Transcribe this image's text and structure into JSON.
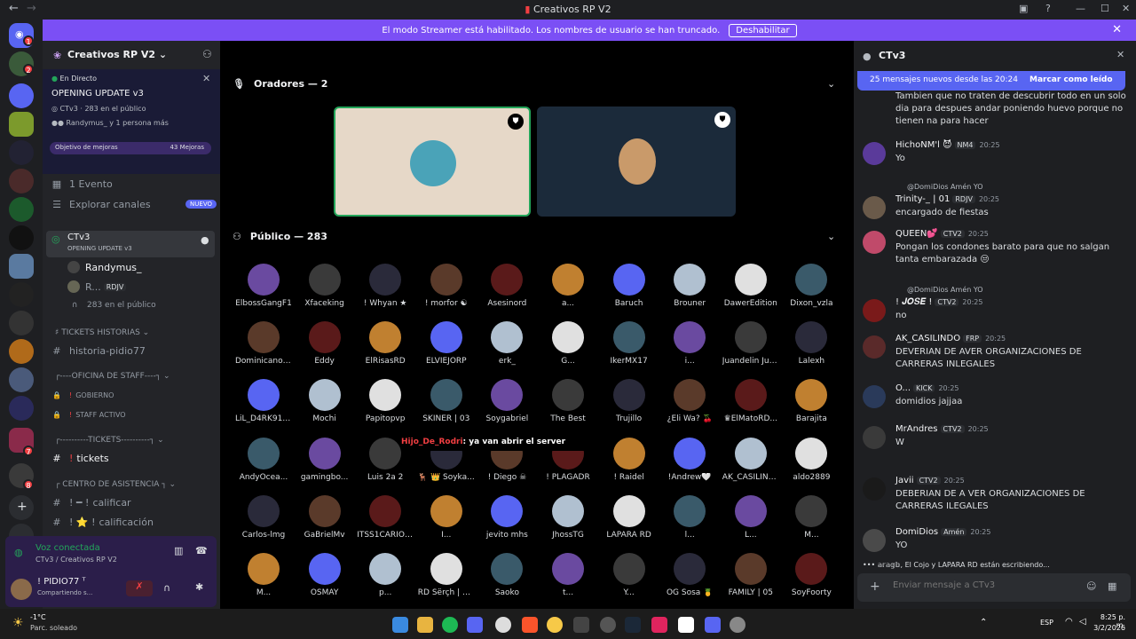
{
  "window": {
    "title": "Creativos RP V2"
  },
  "banner": {
    "text": "El modo Streamer está habilitado. Los nombres de usuario se han truncado.",
    "button": "Deshabilitar"
  },
  "rail_badges": [
    "1",
    "2",
    "2",
    "7",
    "8"
  ],
  "server": {
    "name": "Creativos RP V2",
    "live_label": "En Directo",
    "event_title": "OPENING UPDATE v3",
    "event_channel": "CTv3",
    "event_audience": "283 en el público",
    "event_people": "Randymus_ y 1 persona más",
    "boost_label": "Objetivo de mejoras",
    "boost_count": "43 Mejoras",
    "events_link": "1 Evento",
    "explore_link": "Explorar canales",
    "explore_badge": "NUEVO",
    "stage_channel": "CTv3",
    "stage_topic": "OPENING UPDATE v3",
    "stage_members": [
      "Randymus_",
      "R..."
    ],
    "stage_member_tag": "RDJV",
    "stage_audience": "283 en el público",
    "cat_tickets_hist": "TICKETS HISTORIAS",
    "ch_historia": "historia-pidio77",
    "cat_staff": "┌----OFICINA DE STAFF----┐",
    "ch_gobierno": "GOBIERNO",
    "ch_staff_activo": "STAFF ACTIVO",
    "cat_tickets": "┌----------TICKETS----------┐",
    "ch_tickets": "tickets",
    "cat_asistencia": "┌ CENTRO DE ASISTENCIA ┐",
    "ch_calificar": "calificar",
    "ch_calificacion": "calificación"
  },
  "voice": {
    "status": "Voz conectada",
    "location": "CTv3 / Creativos RP V2",
    "username": "! PIDIO77 ᵀ",
    "substatus": "Compartiendo s..."
  },
  "stage": {
    "speakers_label": "Oradores — 2",
    "audience_label": "Público — 283",
    "speaker_colors": [
      "#e6d8c8",
      "#1b2a3a"
    ],
    "audience": [
      [
        "ElbossGangF1",
        "Xfaceking",
        "! Whyan ★",
        "! morfor ☯",
        "Asesinord",
        "a...",
        "Baruch",
        "Brouner",
        "DawerEdition",
        "Dixon_vzla"
      ],
      [
        "DominicanoG...",
        "Eddy",
        "ElRisasRD",
        "ELVIEJORP",
        "erk_",
        "G...",
        "IkerMX17",
        "i...",
        "Juandelin Jue...",
        "Lalexh"
      ],
      [
        "LiL_D4RK914 ...",
        "Mochi",
        "Papitopvp",
        "SKINER | 03",
        "Soygabriel",
        "The Best",
        "Trujillo",
        "¿Eli Wa? 🍒",
        "♛ElMatoRD...",
        "Barajita"
      ],
      [
        "AndyOcea...",
        "gamingbo...",
        "Luis 2a 2",
        "🦌 👑 Soyka...",
        "! Diego ☠",
        "! PLAGADR",
        "! Raidel",
        "!Andrew🤍",
        "AK_CASILINDO",
        "aldo2889"
      ],
      [
        "Carlos-lmg",
        "GaBrielMv",
        "ITSS1CARIO O...",
        "I...",
        "jevito mhs",
        "JhossTG",
        "LAPARA RD",
        "l...",
        "L...",
        "M..."
      ],
      [
        "M...",
        "OSMAY",
        "p...",
        "RD Šërçh | 20 ...",
        "Saoko",
        "t...",
        "Y...",
        "OG Sosa 🍍",
        "FAMILY | 05",
        "SoyFoorty"
      ]
    ]
  },
  "chat": {
    "channel": "CTv3",
    "new_messages": "25 mensajes nuevos desde las 20:24",
    "mark_read": "Marcar como leído",
    "placeholder": "Enviar mensaje a CTv3",
    "typing": "𝕒𝕣𝕒𝕘𝕓, El Cojo y LAPARA RD están escribiendo...",
    "overlay_name": "Hijo_De_Rodri",
    "overlay_text": ": ya van abrir el server",
    "messages": [
      {
        "author": "",
        "tag": "",
        "time": "",
        "reply": "",
        "text": "Tambien que no traten de descubrir todo en un solo dia para despues andar poniendo huevo porque no tienen na para hacer"
      },
      {
        "author": "HichoNM'l 😈",
        "tag": "NM4",
        "time": "20:25",
        "reply": "",
        "text": "Yo"
      },
      {
        "author": "Trinity-_ | 01",
        "tag": "RDJV",
        "time": "20:25",
        "reply": "@DomiDios Amén YO",
        "text": "encargado de fiestas"
      },
      {
        "author": "QUEEN💕",
        "tag": "CTV2",
        "time": "20:25",
        "reply": "",
        "text": "Pongan los condones barato para que no salgan tanta embarazada 😒"
      },
      {
        "author": "! 𝑱𝑶𝑺𝑬 !",
        "tag": "CTV2",
        "time": "20:25",
        "reply": "@DomiDios Amén YO",
        "text": "no"
      },
      {
        "author": "AK_CASILINDO",
        "tag": "FRP",
        "time": "20:25",
        "reply": "",
        "text": "DEVERIAN DE AVER ORGANIZACIONES DE CARRERAS INLEGALES"
      },
      {
        "author": "O...",
        "tag": "KICK",
        "time": "20:25",
        "reply": "",
        "text": "domidios jajjaa"
      },
      {
        "author": "MrAndres",
        "tag": "CTV2",
        "time": "20:25",
        "reply": "",
        "text": "W"
      },
      {
        "author": "Javii",
        "tag": "CTV2",
        "time": "20:25",
        "reply": "",
        "text": "DEBERIAN DE A VER ORGANIZACIONES DE CARRERAS ILEGALES"
      },
      {
        "author": "DomiDios",
        "tag": "Amén",
        "time": "20:25",
        "reply": "",
        "text": "YO"
      }
    ]
  },
  "taskbar": {
    "weather_temp": "-1°C",
    "weather_desc": "Parc. soleado",
    "lang": "ESP",
    "time": "8:25 p. m.",
    "date": "3/2/2026"
  },
  "colors": {
    "accent": "#5865f2",
    "banner": "#7b4ff5",
    "live": "#23a55a"
  }
}
